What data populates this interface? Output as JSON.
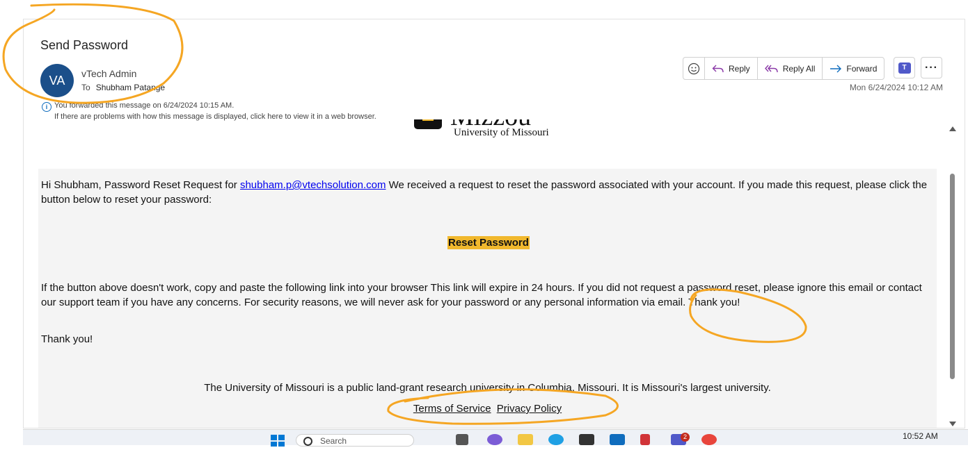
{
  "email": {
    "subject": "Send Password",
    "sender_initials": "VA",
    "sender_name": "vTech Admin",
    "to_label": "To",
    "to_name": "Shubham Patange",
    "info_line1": "You forwarded this message on 6/24/2024 10:15 AM.",
    "info_line2": "If there are problems with how this message is displayed, click here to view it in a web browser.",
    "datetime": "Mon 6/24/2024 10:12 AM"
  },
  "toolbar": {
    "reply": "Reply",
    "reply_all": "Reply All",
    "forward": "Forward"
  },
  "body": {
    "logo_word": "Mizzou",
    "logo_sub": "University of Missouri",
    "greeting_pre": "Hi Shubham, Password Reset Request for ",
    "email_link": "shubham.p@vtechsolution.com",
    "greeting_post": " We received a request to reset the password associated with your account. If you made this request, please click the button below to reset your password:",
    "reset_button": "Reset Password",
    "fallback": "If the button above doesn't work, copy and paste the following link into your browser This link will expire in 24 hours. If you did not request a password reset, please ignore this email or contact our support team if you have any concerns. For security reasons, we will never ask for your password or any personal information via email. Thank you!",
    "thanks": "Thank you!",
    "footer_text": "The University of Missouri is a public land-grant research university in Columbia, Missouri. It is Missouri's largest university.",
    "terms": "Terms of Service",
    "privacy": "Privacy Policy"
  },
  "taskbar": {
    "search_placeholder": "Search",
    "teams_badge": "2",
    "clock": "10:52 AM"
  },
  "colors": {
    "accent": "#0f6cbd",
    "reset_button": "#f1b82d",
    "annotation": "#f5a623",
    "avatar": "#1b4f8a"
  }
}
